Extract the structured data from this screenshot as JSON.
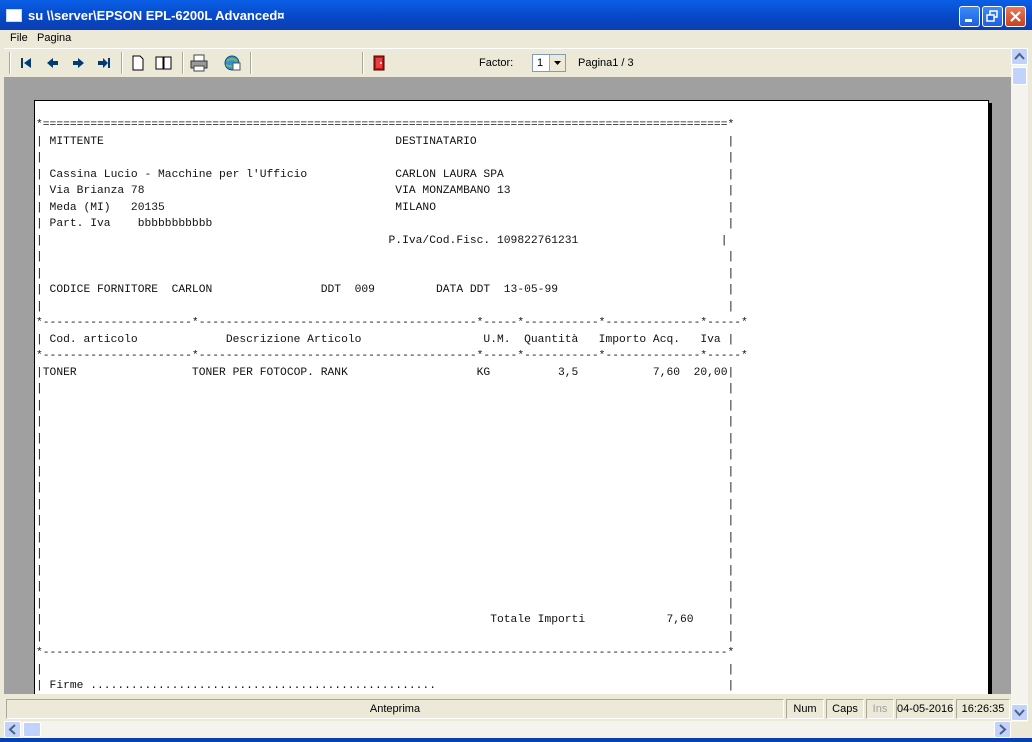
{
  "window": {
    "title": "su \\\\server\\EPSON EPL-6200L Advanced¤"
  },
  "menu": {
    "items": [
      "File",
      "Pagina"
    ]
  },
  "toolbar": {
    "factor_label": "Factor:",
    "factor_value": "1",
    "page_label": "Pagina1 / 3"
  },
  "report": {
    "lines": [
      "*=====================================================================================================*",
      "| MITTENTE                                           DESTINATARIO                                     |",
      "|                                                                                                     |",
      "| Cassina Lucio - Macchine per l'Ufficio             CARLON LAURA SPA                                 |",
      "| Via Brianza 78                                     VIA MONZAMBANO 13                                |",
      "| Meda (MI)   20135                                  MILANO                                           |",
      "| Part. Iva    bbbbbbbbbbb                                                                            |",
      "|                                                   P.Iva/Cod.Fisc. 109822761231                     |",
      "|                                                                                                     |",
      "|                                                                                                     |",
      "| CODICE FORNITORE  CARLON                DDT  009         DATA DDT  13-05-99                         |",
      "|                                                                                                     |",
      "*----------------------*-----------------------------------------*-----*-----------*--------------*-----*",
      "| Cod. articolo             Descrizione Articolo                  U.M.  Quantità   Importo Acq.   Iva |",
      "*----------------------*-----------------------------------------*-----*-----------*--------------*-----*",
      "|TONER                 TONER PER FOTOCOP. RANK                   KG          3,5           7,60  20,00|",
      "|                                                                                                     |",
      "|                                                                                                     |",
      "|                                                                                                     |",
      "|                                                                                                     |",
      "|                                                                                                     |",
      "|                                                                                                     |",
      "|                                                                                                     |",
      "|                                                                                                     |",
      "|                                                                                                     |",
      "|                                                                                                     |",
      "|                                                                                                     |",
      "|                                                                                                     |",
      "|                                                                                                     |",
      "|                                                                                                     |",
      "|                                                                  Totale Importi            7,60     |",
      "|                                                                                                     |",
      "*-----------------------------------------------------------------------------------------------------*",
      "|                                                                                                     |",
      "| Firme ...................................................                                           |"
    ]
  },
  "status": {
    "mode": "Anteprima",
    "num": "Num",
    "caps": "Caps",
    "ins": "Ins",
    "date": "04-05-2016",
    "time": "16:26:35"
  },
  "colors": {
    "titlebar": "#0a5fe6",
    "chrome": "#ece9d8",
    "preview_bg": "#a0a0a0"
  }
}
